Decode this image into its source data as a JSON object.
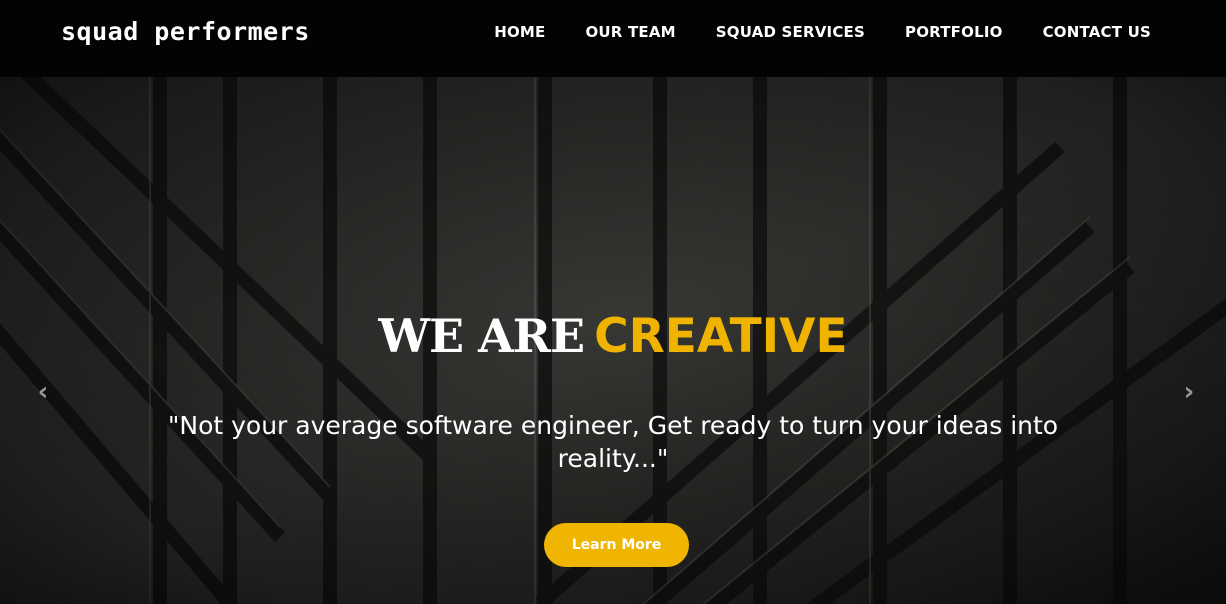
{
  "brand": {
    "name": "squad performers"
  },
  "nav": {
    "items": [
      {
        "label": "HOME"
      },
      {
        "label": "OUR TEAM"
      },
      {
        "label": "SQUAD SERVICES"
      },
      {
        "label": "PORTFOLIO"
      },
      {
        "label": "CONTACT US"
      }
    ]
  },
  "hero": {
    "headline_main": "WE ARE",
    "headline_accent": "CREATIVE",
    "tagline": "\"Not your average software engineer, Get ready to turn your ideas into reality...\"",
    "cta_label": "Learn More",
    "prev_icon": "chevron-left-icon",
    "next_icon": "chevron-right-icon"
  },
  "colors": {
    "accent": "#efb500",
    "navbar": "#030303",
    "text": "#ffffff"
  }
}
